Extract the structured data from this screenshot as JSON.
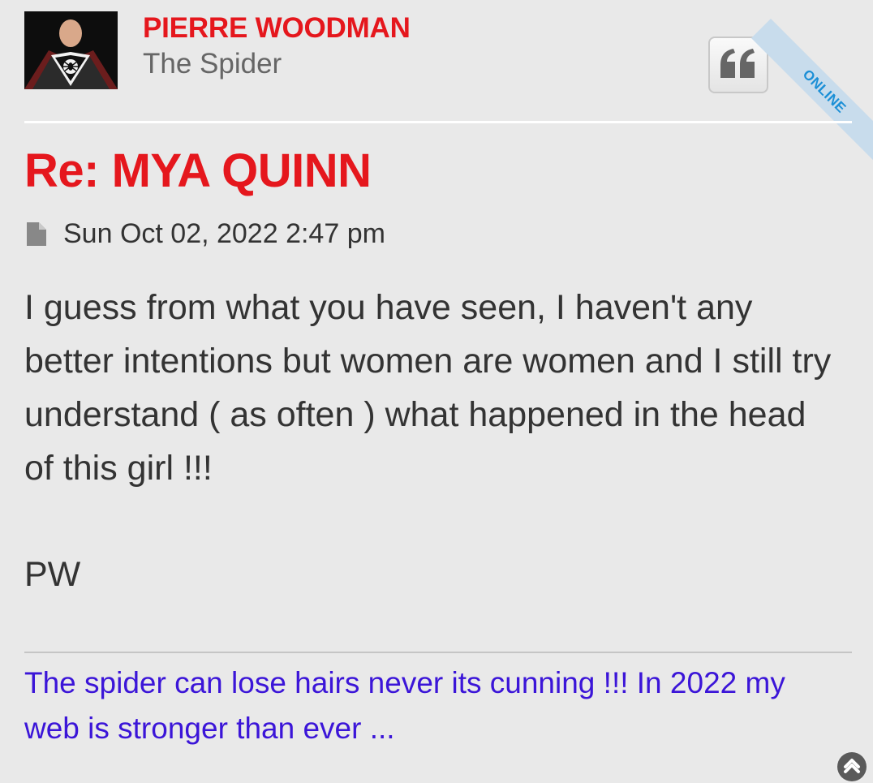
{
  "author": {
    "name": "PIERRE WOODMAN",
    "rank": "The Spider",
    "status": "ONLINE",
    "avatar_icon": "spider-superhero-avatar"
  },
  "post": {
    "title": "Re: MYA QUINN",
    "date": "Sun Oct 02, 2022 2:47 pm",
    "body": "I guess from what you have seen, I haven't any better intentions but women are women and I still try understand ( as often ) what happened in the head of this girl !!!",
    "sign_off": "PW"
  },
  "signature": "The spider can lose hairs never its cunning !!! In 2022 my web is stronger than ever ...",
  "icons": {
    "quote": "quote-icon",
    "post": "file-icon",
    "top": "chevron-up-icon"
  },
  "colors": {
    "background": "#e9e9e9",
    "accent_red": "#e5171d",
    "signature_link": "#3b15d8",
    "online_ribbon": "#1b8fd6"
  }
}
